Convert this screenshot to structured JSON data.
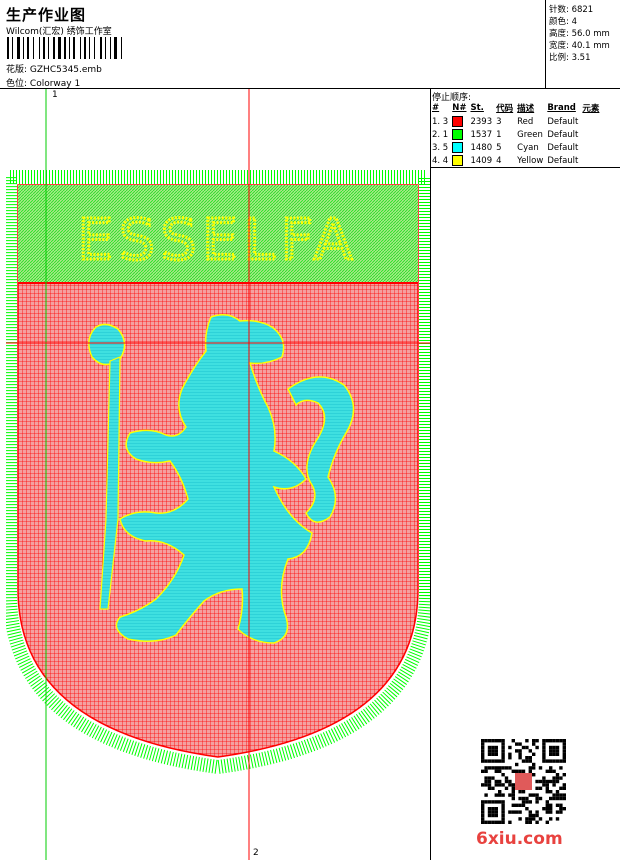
{
  "header": {
    "title": "生产作业图",
    "subtitle": "Wilcom(汇宏) 绣饰工作室",
    "design_label": "花版:",
    "design_value": "GZHC5345.emb",
    "colorway_label": "色位:",
    "colorway_value": "Colorway 1"
  },
  "stats": {
    "stitches": "针数: 6821",
    "colors": "颜色: 4",
    "height": "高度: 56.0 mm",
    "width": "宽度: 40.1 mm",
    "ratio": "比例: 3.51"
  },
  "stop_sequence": {
    "title": "停止顺序:",
    "headers": [
      "#",
      "N#",
      "St.",
      "代码",
      "描述",
      "Brand",
      "元素"
    ],
    "rows": [
      {
        "idx": "1. 3",
        "color": "#ff0000",
        "stitches": "2393",
        "code": "3",
        "desc": "Red",
        "brand": "Default"
      },
      {
        "idx": "2. 1",
        "color": "#00ff00",
        "stitches": "1537",
        "code": "1",
        "desc": "Green",
        "brand": "Default"
      },
      {
        "idx": "3. 5",
        "color": "#00ffff",
        "stitches": "1480",
        "code": "5",
        "desc": "Cyan",
        "brand": "Default"
      },
      {
        "idx": "4. 4",
        "color": "#ffff00",
        "stitches": "1409",
        "code": "4",
        "desc": "Yellow",
        "brand": "Default"
      }
    ]
  },
  "design": {
    "banner_text": "ESSELFA",
    "guide1": "1",
    "guide2": "2",
    "colors": {
      "red": "#ff0000",
      "green": "#00ff00",
      "cyan": "#00ffff",
      "yellow": "#ffff00",
      "banner_bg": "#9be27a",
      "field": "#f08080"
    }
  },
  "watermark": "6xiu.com"
}
